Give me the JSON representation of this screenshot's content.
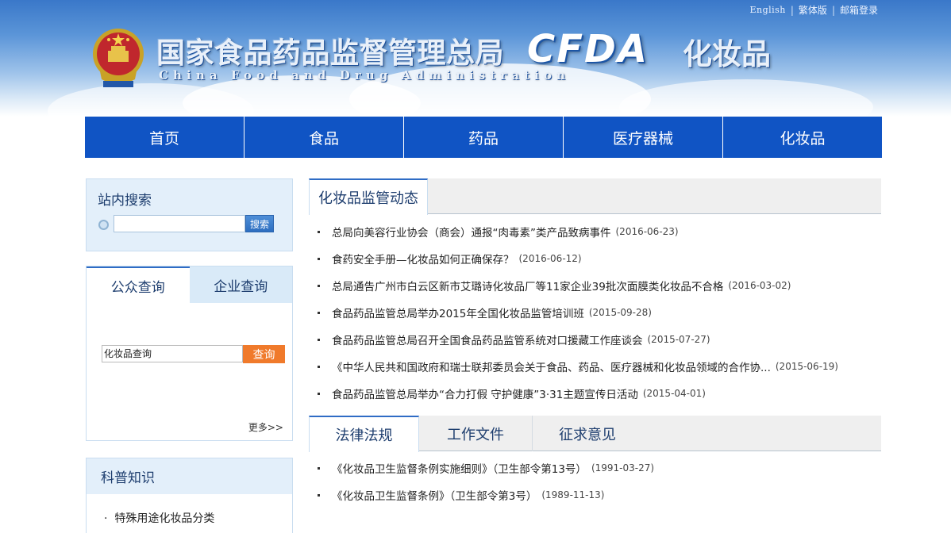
{
  "header": {
    "top_links": [
      "English",
      "繁体版",
      "邮箱登录"
    ],
    "title_cn": "国家食品药品监督管理总局",
    "title_en": "China Food and Drug Administration",
    "logo_text": "CFDA",
    "section_title": "化妆品"
  },
  "nav": [
    "首页",
    "食品",
    "药品",
    "医疗器械",
    "化妆品"
  ],
  "site_search": {
    "title": "站内搜索",
    "input_value": "",
    "button": "搜索"
  },
  "query": {
    "tabs": [
      "公众查询",
      "企业查询"
    ],
    "input_value": "化妆品查询",
    "button": "查询",
    "more": "更多>>"
  },
  "science": {
    "title": "科普知识",
    "items": [
      "特殊用途化妆品分类"
    ]
  },
  "news_panel": {
    "tab": "化妆品监管动态",
    "items": [
      {
        "title": "总局向美容行业协会（商会）通报“肉毒素”类产品致病事件",
        "date": "(2016-06-23)"
      },
      {
        "title": "食药安全手册—化妆品如何正确保存？",
        "date": "(2016-06-12)"
      },
      {
        "title": "总局通告广州市白云区新市艾璐诗化妆品厂等11家企业39批次面膜类化妆品不合格",
        "date": "(2016-03-02)"
      },
      {
        "title": "食品药品监管总局举办2015年全国化妆品监管培训班",
        "date": "(2015-09-28)"
      },
      {
        "title": "食品药品监管总局召开全国食品药品监管系统对口援藏工作座谈会",
        "date": "(2015-07-27)"
      },
      {
        "title": "《中华人民共和国政府和瑞士联邦委员会关于食品、药品、医疗器械和化妆品领域的合作协...",
        "date": "(2015-06-19)"
      },
      {
        "title": "食品药品监管总局举办“合力打假 守护健康”3·31主题宣传日活动",
        "date": "(2015-04-01)"
      }
    ]
  },
  "law_panel": {
    "tabs": [
      "法律法规",
      "工作文件",
      "征求意见"
    ],
    "items": [
      {
        "title": "《化妆品卫生监督条例实施细则》（卫生部令第13号）",
        "date": "(1991-03-27)"
      },
      {
        "title": "《化妆品卫生监督条例》（卫生部令第3号）",
        "date": "(1989-11-13)"
      }
    ]
  },
  "colors": {
    "nav_bg": "#1054c4",
    "query_button": "#f07a2b",
    "panel_accent": "#2f6cc5"
  }
}
